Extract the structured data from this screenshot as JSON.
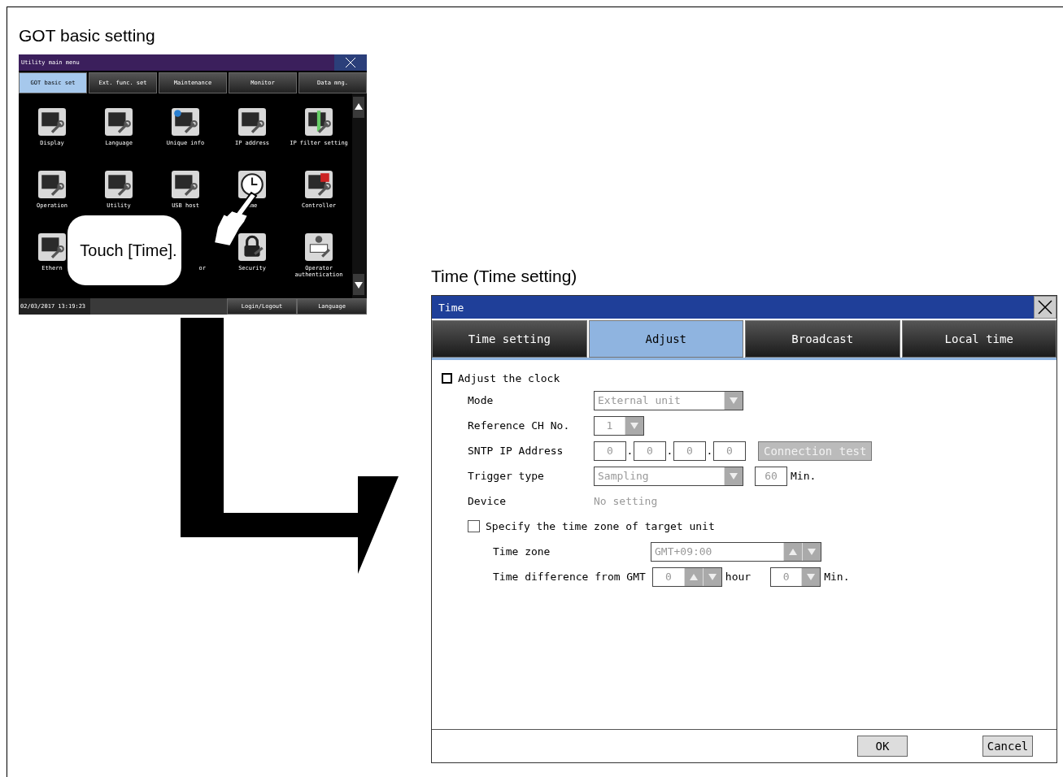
{
  "left_heading": "GOT basic setting",
  "utility_menu": {
    "title": "Utility main menu",
    "tabs": [
      {
        "label": "GOT basic set",
        "selected": true
      },
      {
        "label": "Ext. func. set",
        "selected": false
      },
      {
        "label": "Maintenance",
        "selected": false
      },
      {
        "label": "Monitor",
        "selected": false
      },
      {
        "label": "Data mng.",
        "selected": false
      }
    ],
    "items": [
      {
        "label": "Display",
        "kind": "screen"
      },
      {
        "label": "Language",
        "kind": "language"
      },
      {
        "label": "Unique info",
        "kind": "info"
      },
      {
        "label": "IP address",
        "kind": "network"
      },
      {
        "label": "IP filter setting",
        "kind": "filter"
      },
      {
        "label": "Operation",
        "kind": "touch"
      },
      {
        "label": "Utility",
        "kind": "hand"
      },
      {
        "label": "USB host",
        "kind": "usb"
      },
      {
        "label": "ime",
        "kind": "clock"
      },
      {
        "label": "Controller",
        "kind": "controller"
      },
      {
        "label": "Ethern",
        "kind": "network"
      },
      {
        "kind": "covered"
      },
      {
        "label": "or",
        "kind": "covered"
      },
      {
        "label": "Security",
        "kind": "lock"
      },
      {
        "label": "Operator authentication",
        "kind": "person"
      }
    ],
    "status_time": "02/03/2017 13:19:23",
    "buttons": [
      "Login/Logout",
      "Language"
    ]
  },
  "callout": "Touch [Time].",
  "right_heading": "Time (Time setting)",
  "dialog": {
    "title": "Time",
    "tabs": [
      {
        "label": "Time setting",
        "selected": false
      },
      {
        "label": "Adjust",
        "selected": true
      },
      {
        "label": "Broadcast",
        "selected": false
      },
      {
        "label": "Local time",
        "selected": false
      }
    ],
    "adjust_checkbox": {
      "label": "Adjust the clock",
      "checked": false
    },
    "mode": {
      "label": "Mode",
      "value": "External unit",
      "disabled": true
    },
    "ref_ch": {
      "label": "Reference CH No.",
      "value": "1",
      "disabled": true
    },
    "sntp": {
      "label": "SNTP IP Address",
      "octets": [
        "0",
        "0",
        "0",
        "0"
      ],
      "separators": [
        ".",
        ".",
        "."
      ],
      "test_button": "Connection test",
      "disabled": true
    },
    "trigger": {
      "label": "Trigger type",
      "value": "Sampling",
      "interval": "60",
      "unit": "Min.",
      "disabled": true
    },
    "device": {
      "label": "Device",
      "value": "No setting",
      "disabled": true
    },
    "timezone_checkbox": {
      "label": "Specify the time zone of target unit",
      "checked": false
    },
    "time_zone": {
      "label": "Time zone",
      "value": "GMT+09:00",
      "disabled": true
    },
    "time_diff": {
      "label": "Time difference from GMT",
      "hours": "0",
      "hour_unit": "hour",
      "minutes": "0",
      "min_unit": "Min.",
      "disabled": true
    },
    "buttons": [
      "OK",
      "Cancel"
    ]
  }
}
